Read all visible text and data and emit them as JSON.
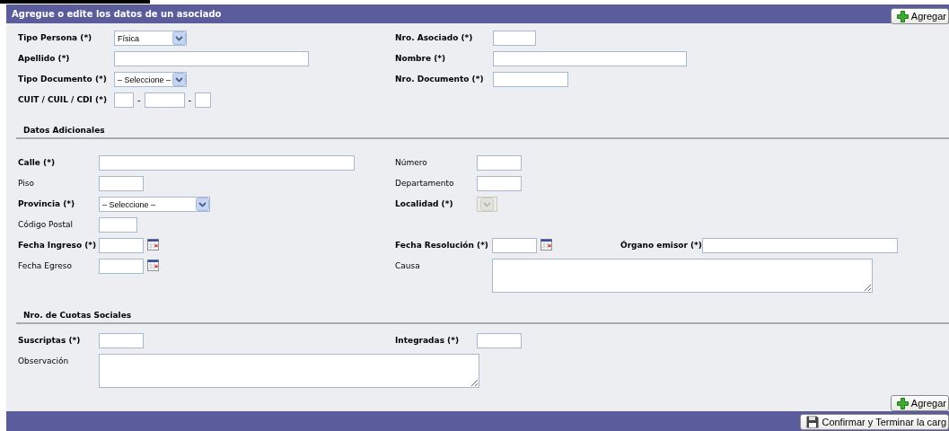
{
  "panel": {
    "title": "Agregue o edite los datos de un asociado",
    "header_button": {
      "label": "Agregar"
    }
  },
  "sections": [
    {
      "rows": [
        {
          "cells": [
            {
              "label": "Tipo Persona (*)",
              "required": true,
              "kind": "select",
              "value": "Física",
              "disabled": false
            },
            {
              "label": "Nro. Asociado (*)",
              "required": true,
              "kind": "text"
            }
          ]
        },
        {
          "cells": [
            {
              "label": "Apellido (*)",
              "required": true,
              "kind": "text"
            },
            {
              "label": "Nombre (*)",
              "required": true,
              "kind": "text"
            }
          ]
        },
        {
          "cells": [
            {
              "label": "Tipo Documento (*)",
              "required": true,
              "kind": "select",
              "value": "– Seleccione –",
              "disabled": false
            },
            {
              "label": "Nro. Documento (*)",
              "required": true,
              "kind": "text"
            }
          ]
        },
        {
          "cells": [
            {
              "label": "CUIT / CUIL / CDI (*)",
              "required": true,
              "kind": "cuit",
              "separators": [
                "-",
                "-"
              ]
            }
          ]
        }
      ]
    },
    {
      "title": "Datos Adicionales",
      "rows": [
        {
          "cells": [
            {
              "label": "Calle (*)",
              "required": true,
              "kind": "text"
            },
            {
              "label": "Número",
              "required": false,
              "kind": "text"
            }
          ]
        },
        {
          "cells": [
            {
              "label": "Piso",
              "required": false,
              "kind": "text"
            },
            {
              "label": "Departamento",
              "required": false,
              "kind": "text"
            }
          ]
        },
        {
          "cells": [
            {
              "label": "Provincia (*)",
              "required": true,
              "kind": "select",
              "value": "– Seleccione –",
              "disabled": false
            },
            {
              "label": "Localidad (*)",
              "required": true,
              "kind": "select",
              "disabled": true
            }
          ]
        },
        {
          "cells": [
            {
              "label": "Código Postal",
              "required": false,
              "kind": "text"
            }
          ]
        },
        {
          "cells": [
            {
              "label": "Fecha Ingreso (*)",
              "required": true,
              "kind": "date"
            },
            {
              "label": "Fecha Resolución (*)",
              "required": true,
              "kind": "date"
            },
            {
              "label": "Órgano emisor (*)",
              "required": true,
              "kind": "text"
            }
          ]
        },
        {
          "cells": [
            {
              "label": "Fecha Egreso",
              "required": false,
              "kind": "date"
            },
            {
              "label": "Causa",
              "required": false,
              "kind": "textarea"
            }
          ]
        }
      ]
    },
    {
      "title": "Nro. de Cuotas Sociales",
      "rows": [
        {
          "cells": [
            {
              "label": "Suscriptas (*)",
              "required": true,
              "kind": "text"
            },
            {
              "label": "Integradas (*)",
              "required": true,
              "kind": "text"
            }
          ]
        },
        {
          "cells": [
            {
              "label": "Observación",
              "required": false,
              "kind": "textarea"
            }
          ]
        }
      ]
    }
  ],
  "bottom_button": {
    "label": "Agregar"
  },
  "footer": {
    "button": {
      "label": "Confirmar y Terminar la carg"
    }
  }
}
